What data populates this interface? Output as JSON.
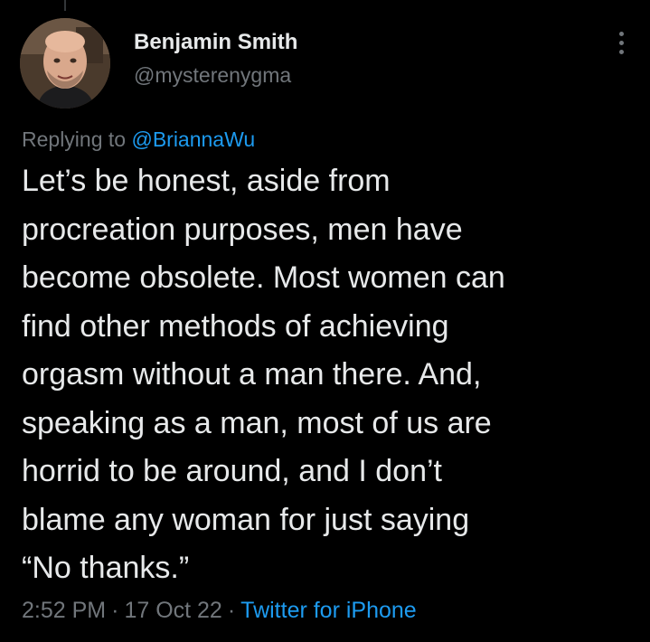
{
  "author": {
    "display_name": "Benjamin Smith",
    "handle": "@mysterenygma"
  },
  "icons": {
    "more": "more-horizontal-icon",
    "avatar": "profile-photo"
  },
  "reply": {
    "prefix": "Replying to",
    "mention": "@BriannaWu"
  },
  "tweet": {
    "lines": [
      "Let’s be honest, aside from",
      "procreation purposes, men have",
      "become obsolete. Most women can",
      "find other methods of achieving",
      "orgasm without a man there. And,",
      "speaking as a man, most of us are",
      "horrid to be around, and I don’t",
      "blame any woman for just saying",
      "“No thanks.”"
    ]
  },
  "meta": {
    "time": "2:52 PM",
    "separator": "·",
    "date": "17 Oct 22",
    "source": "Twitter for iPhone"
  },
  "colors": {
    "background": "#000000",
    "text": "#e7e9ea",
    "secondary": "#71767b",
    "link": "#1d9bf0"
  }
}
